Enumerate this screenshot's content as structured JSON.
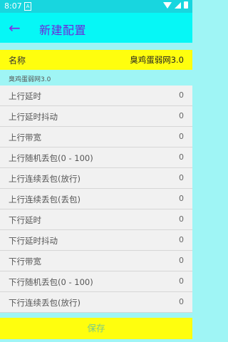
{
  "status": {
    "time": "8:07",
    "notif": "A"
  },
  "appbar": {
    "back_icon": "arrow-left-icon",
    "title": "新建配置"
  },
  "name_field": {
    "label": "名称",
    "value": "臭鸡蛋弱网3.0"
  },
  "section_label": "臭鸡蛋弱网3.0",
  "rows": [
    {
      "label": "上行延时",
      "value": "0"
    },
    {
      "label": "上行延时抖动",
      "value": "0"
    },
    {
      "label": "上行带宽",
      "value": "0"
    },
    {
      "label": "上行随机丢包(0 - 100)",
      "value": "0"
    },
    {
      "label": "上行连续丢包(放行)",
      "value": "0"
    },
    {
      "label": "上行连续丢包(丢包)",
      "value": "0"
    },
    {
      "label": "下行延时",
      "value": "0"
    },
    {
      "label": "下行延时抖动",
      "value": "0"
    },
    {
      "label": "下行带宽",
      "value": "0"
    },
    {
      "label": "下行随机丢包(0 - 100)",
      "value": "0"
    },
    {
      "label": "下行连续丢包(放行)",
      "value": "0"
    }
  ],
  "save_label": "保存",
  "colors": {
    "appbar": "#06f7f6",
    "accent": "#7e2fe4",
    "highlight": "#fffe0e",
    "background": "#9ff5f5"
  }
}
